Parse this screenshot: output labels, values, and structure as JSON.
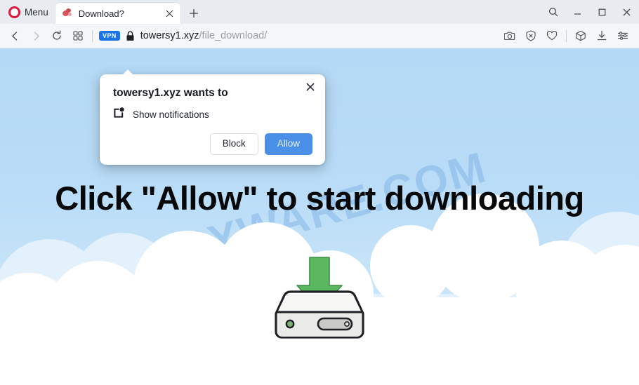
{
  "browser": {
    "name": "Opera",
    "menu_label": "Menu",
    "menu_icon": "opera-logo-icon",
    "tab": {
      "title": "Download?",
      "favicon": "site-favicon-icon",
      "close_icon": "close-icon"
    },
    "new_tab_label": "+",
    "window_controls": {
      "search_icon": "search-icon",
      "minimize_icon": "minimize-icon",
      "maximize_icon": "maximize-icon",
      "close_icon": "close-icon"
    },
    "navbar": {
      "back_icon": "back-arrow-icon",
      "forward_icon": "forward-arrow-icon",
      "reload_icon": "reload-icon",
      "speed_dial_icon": "grid-speed-dial-icon",
      "vpn_badge": "VPN",
      "lock_icon": "lock-icon",
      "url_host": "towersy1.xyz",
      "url_path": "/file_download/",
      "url_full": "towersy1.xyz/file_download/",
      "right_icons": [
        {
          "name": "snapshot-camera-icon",
          "label": "Snapshot"
        },
        {
          "name": "ad-blocker-shield-icon",
          "label": "Ad blocker"
        },
        {
          "name": "heart-favorites-icon",
          "label": "Add to favorites"
        },
        {
          "name": "cube-extensions-icon",
          "label": "Extensions"
        },
        {
          "name": "downloads-icon",
          "label": "Downloads"
        },
        {
          "name": "easy-setup-sliders-icon",
          "label": "Easy setup"
        }
      ]
    }
  },
  "permission_dialog": {
    "title": "towersy1.xyz wants to",
    "permission_icon": "notifications-icon",
    "permission_label": "Show notifications",
    "block_label": "Block",
    "allow_label": "Allow",
    "close_icon": "close-icon",
    "allow_color": "#4a90e8"
  },
  "page": {
    "headline": "Click \"Allow\" to start downloading",
    "watermark": "MYANTISPYWARE.COM",
    "illustration": "download-to-drive-icon",
    "colors": {
      "sky": "#b4daf6",
      "cloud": "#ffffff",
      "arrow_green": "#5cb860",
      "drive_body": "#efefed",
      "watermark_blue": "#5696d8"
    }
  }
}
